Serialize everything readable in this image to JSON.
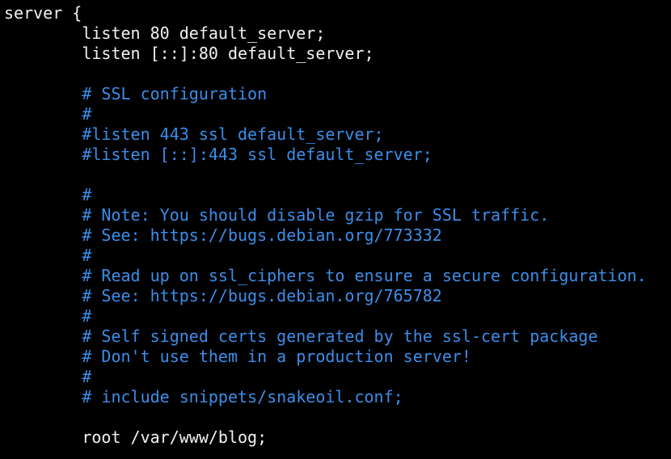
{
  "colors": {
    "background": "#000000",
    "code": "#f2f2f2",
    "comment": "#3b8eea"
  },
  "lines": [
    {
      "text": "server {",
      "kind": "code"
    },
    {
      "text": "        listen 80 default_server;",
      "kind": "code"
    },
    {
      "text": "        listen [::]:80 default_server;",
      "kind": "code"
    },
    {
      "text": "",
      "kind": "blank"
    },
    {
      "text": "        # SSL configuration",
      "kind": "comment"
    },
    {
      "text": "        #",
      "kind": "comment"
    },
    {
      "text": "        #listen 443 ssl default_server;",
      "kind": "comment"
    },
    {
      "text": "        #listen [::]:443 ssl default_server;",
      "kind": "comment"
    },
    {
      "text": "",
      "kind": "blank"
    },
    {
      "text": "        #",
      "kind": "comment"
    },
    {
      "text": "        # Note: You should disable gzip for SSL traffic.",
      "kind": "comment"
    },
    {
      "text": "        # See: https://bugs.debian.org/773332",
      "kind": "comment"
    },
    {
      "text": "        #",
      "kind": "comment"
    },
    {
      "text": "        # Read up on ssl_ciphers to ensure a secure configuration.",
      "kind": "comment"
    },
    {
      "text": "        # See: https://bugs.debian.org/765782",
      "kind": "comment"
    },
    {
      "text": "        #",
      "kind": "comment"
    },
    {
      "text": "        # Self signed certs generated by the ssl-cert package",
      "kind": "comment"
    },
    {
      "text": "        # Don't use them in a production server!",
      "kind": "comment"
    },
    {
      "text": "        #",
      "kind": "comment"
    },
    {
      "text": "        # include snippets/snakeoil.conf;",
      "kind": "comment"
    },
    {
      "text": "",
      "kind": "blank"
    },
    {
      "text": "        root /var/www/blog;",
      "kind": "code"
    }
  ]
}
